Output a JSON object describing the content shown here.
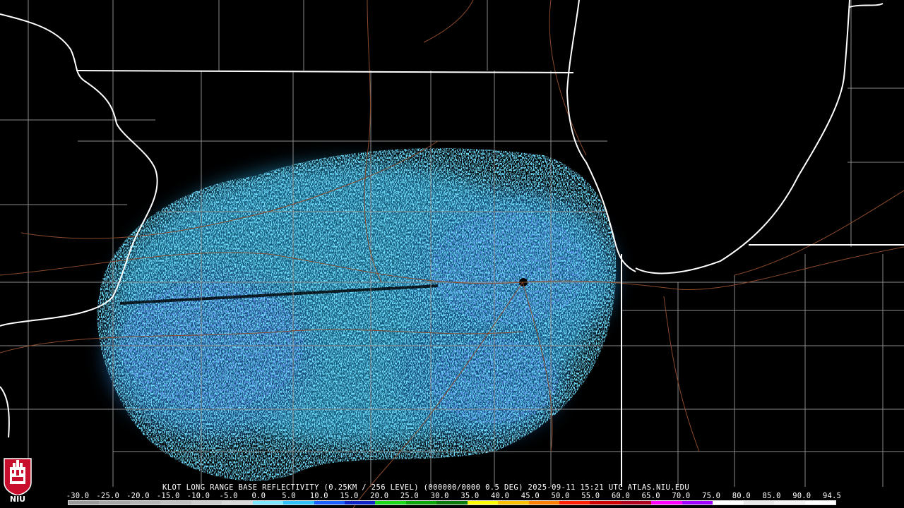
{
  "caption": "KLOT LONG RANGE BASE REFLECTIVITY (0.25KM / 256 LEVEL) (000000/0000 0.5 DEG) 2025-09-11 15:21 UTC  ATLAS.NIU.EDU",
  "scale": {
    "labels": [
      "-30.0",
      "-25.0",
      "-20.0",
      "-15.0",
      "-10.0",
      "-5.0",
      "0.0",
      "5.0",
      "10.0",
      "15.0",
      "20.0",
      "25.0",
      "30.0",
      "35.0",
      "40.0",
      "45.0",
      "50.0",
      "55.0",
      "60.0",
      "65.0",
      "70.0",
      "75.0",
      "80.0",
      "85.0",
      "90.0",
      "94.5"
    ],
    "colors": [
      "#9a9a9a",
      "#a7a7a7",
      "#b4b4b4",
      "#c0c0c0",
      "#cccccc",
      "#d8d8d8",
      "#7ce8ff",
      "#2fc0ff",
      "#1b60ff",
      "#1025c8",
      "#18d818",
      "#0aa60a",
      "#0a7a0a",
      "#ffff00",
      "#ffc000",
      "#ff8000",
      "#ff2000",
      "#d00000",
      "#b00020",
      "#ff00ff",
      "#a000ff",
      "#ffffff",
      "#e8e8e8",
      "#f4f4f4",
      "#ffffff"
    ]
  },
  "logo": {
    "text": "NIU",
    "icon": "niu-shield-icon"
  },
  "colors": {
    "radar_light": "#35c8ff",
    "radar_mid": "#1aa6e6",
    "radar_dark": "#1e48d8",
    "state_lines": "#ffffff",
    "county_lines": "#8a8a8a",
    "roads": "#8b4a2b"
  }
}
